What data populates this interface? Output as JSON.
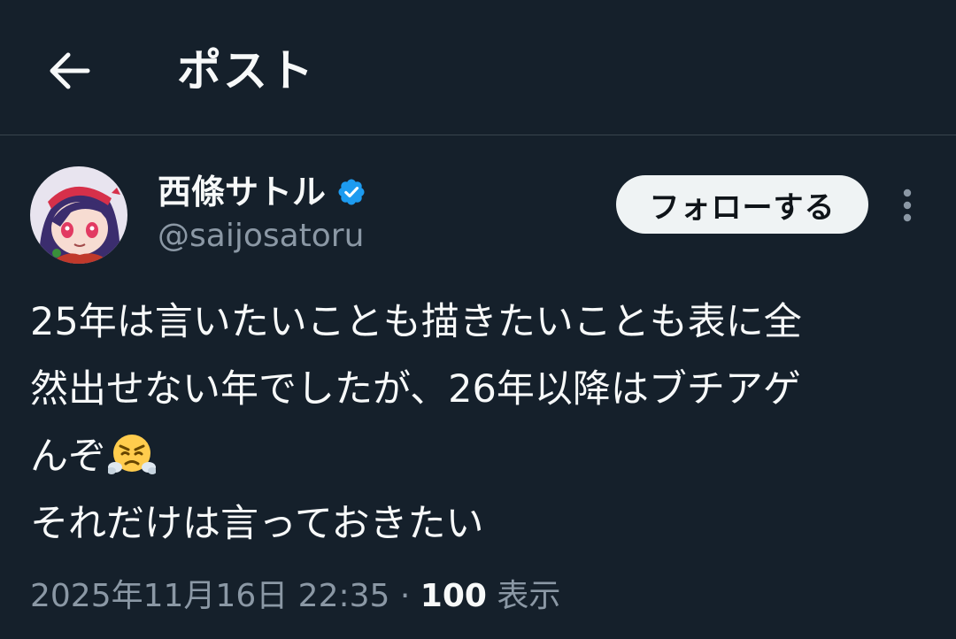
{
  "header": {
    "back_icon": "arrow-left-icon",
    "title": "ポスト"
  },
  "author": {
    "display_name": "西條サトル",
    "verified_icon": "verified-badge-icon",
    "handle": "@saijosatoru",
    "avatar": "avatar"
  },
  "actions": {
    "follow_label": "フォローする",
    "more_icon": "more-vertical-icon"
  },
  "post": {
    "lines": [
      "25年は言いたいことも描きたいことも表に全",
      "然出せない年でしたが、26年以降はブチアゲ",
      "んぞ",
      "それだけは言っておきたい"
    ],
    "emoji": "face-with-steam-from-nose-emoji"
  },
  "meta": {
    "date": "2025年11月16日 22:35",
    "separator": "·",
    "view_count": "100",
    "view_label": "表示"
  },
  "colors": {
    "background": "#15202b",
    "primary_text": "#f7f9f9",
    "secondary_text": "#8b98a5",
    "verified_blue": "#1d9bf0",
    "divider": "#38444d",
    "button_bg": "#eff3f4"
  }
}
